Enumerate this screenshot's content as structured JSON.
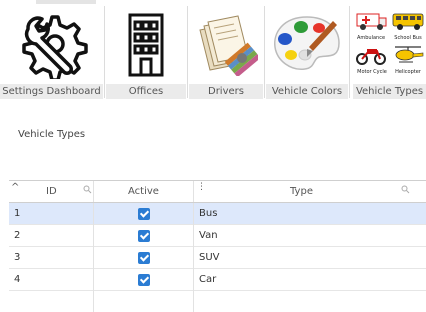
{
  "toolbar": {
    "tiles": [
      {
        "label": "Settings Dashboard",
        "icon": "gear-wrench-icon"
      },
      {
        "label": "Offices",
        "icon": "office-building-icon"
      },
      {
        "label": "Drivers",
        "icon": "drivers-icon"
      },
      {
        "label": "Vehicle Colors",
        "icon": "palette-icon"
      },
      {
        "label": "Vehicle Types",
        "icon": "vehicle-types-icon"
      }
    ],
    "vehicle_types_thumb": {
      "ambulance": "Ambulance",
      "school_bus": "School Bus",
      "motor_cycle": "Motor Cycle",
      "helicopter": "Helicopter"
    }
  },
  "section": {
    "title": "Vehicle Types"
  },
  "grid": {
    "sort_icon": "^",
    "columns": {
      "id": "ID",
      "active": "Active",
      "type": "Type",
      "type_sort": "⋮"
    },
    "rows": [
      {
        "id": "1",
        "active": true,
        "type": "Bus"
      },
      {
        "id": "2",
        "active": true,
        "type": "Van"
      },
      {
        "id": "3",
        "active": true,
        "type": "SUV"
      },
      {
        "id": "4",
        "active": true,
        "type": "Car"
      }
    ],
    "selected_row": 0
  },
  "colors": {
    "selection": "#dde8fb",
    "checkbox": "#2b7cd3",
    "label_bg": "#ebebeb"
  }
}
